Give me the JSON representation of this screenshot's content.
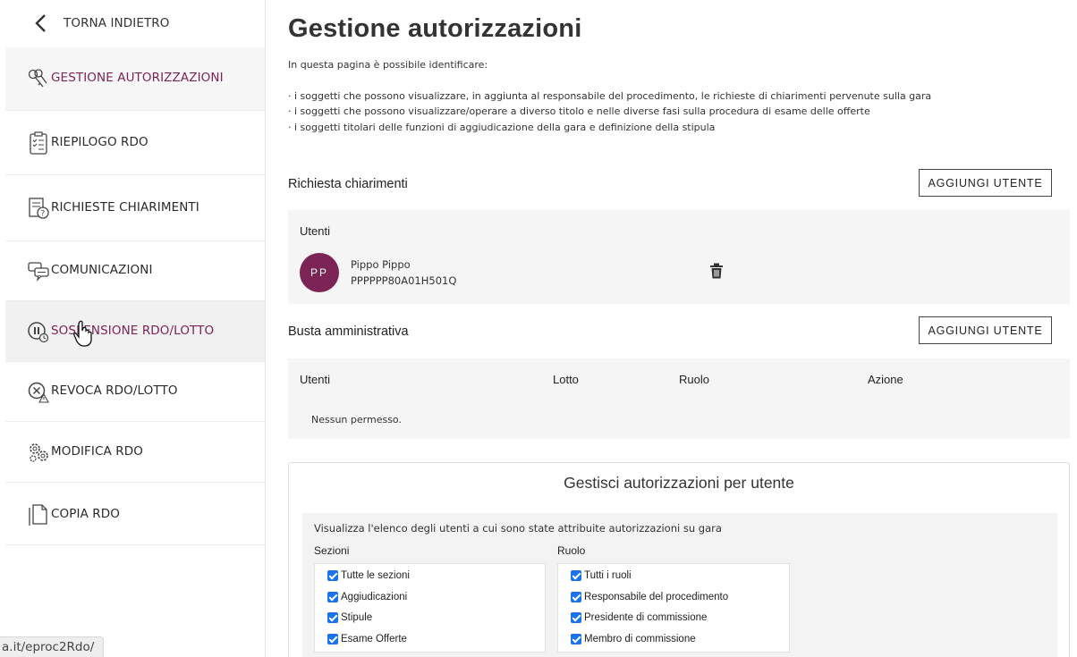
{
  "sidebar": {
    "back_label": "TORNA INDIETRO",
    "items": [
      {
        "label": "GESTIONE AUTORIZZAZIONI",
        "icon": "keys-icon"
      },
      {
        "label": "RIEPILOGO RDO",
        "icon": "clipboard-icon"
      },
      {
        "label": "RICHIESTE CHIARIMENTI",
        "icon": "document-question-icon"
      },
      {
        "label": "COMUNICAZIONI",
        "icon": "chat-bubbles-icon"
      },
      {
        "label": "SOSPENSIONE RDO/LOTTO",
        "icon": "pause-clock-icon"
      },
      {
        "label": "REVOCA RDO/LOTTO",
        "icon": "revoke-icon"
      },
      {
        "label": "MODIFICA RDO",
        "icon": "gears-icon"
      },
      {
        "label": "COPIA RDO",
        "icon": "copy-icon"
      }
    ]
  },
  "status_url": "a.it/eproc2Rdo/",
  "main": {
    "title": "Gestione autorizzazioni",
    "intro": "In questa pagina è possibile identificare:",
    "bullets": [
      "· i soggetti che possono visualizzare, in aggiunta al responsabile del procedimento, le richieste di chiarimenti pervenute sulla gara",
      "· i soggetti che possono visualizzare/operare a diverso titolo e nelle diverse fasi sulla procedura di esame delle offerte",
      "· i soggetti titolari delle funzioni di aggiudicazione della gara e definizione della stipula"
    ],
    "richiesta": {
      "title": "Richiesta chiarimenti",
      "add_label": "AGGIUNGI UTENTE",
      "users_label": "Utenti",
      "user": {
        "initials": "PP",
        "name": "Pippo Pippo",
        "cf": "PPPPPP80A01H501Q"
      }
    },
    "busta": {
      "title": "Busta amministrativa",
      "add_label": "AGGIUNGI UTENTE",
      "columns": [
        "Utenti",
        "Lotto",
        "Ruolo",
        "Azione"
      ],
      "empty": "Nessun permesso."
    },
    "gestisci": {
      "title": "Gestisci autorizzazioni per utente",
      "description": "Visualizza l'elenco degli utenti a cui sono state attribuite autorizzazioni su gara",
      "sezioni_label": "Sezioni",
      "sezioni": [
        "Tutte le sezioni",
        "Aggiudicazioni",
        "Stipule",
        "Esame Offerte"
      ],
      "ruolo_label": "Ruolo",
      "ruoli": [
        "Tutti i ruoli",
        "Responsabile del procedimento",
        "Presidente di commissione",
        "Membro di commissione"
      ]
    }
  },
  "colors": {
    "accent": "#7b2455",
    "checkbox": "#1a73e8"
  }
}
